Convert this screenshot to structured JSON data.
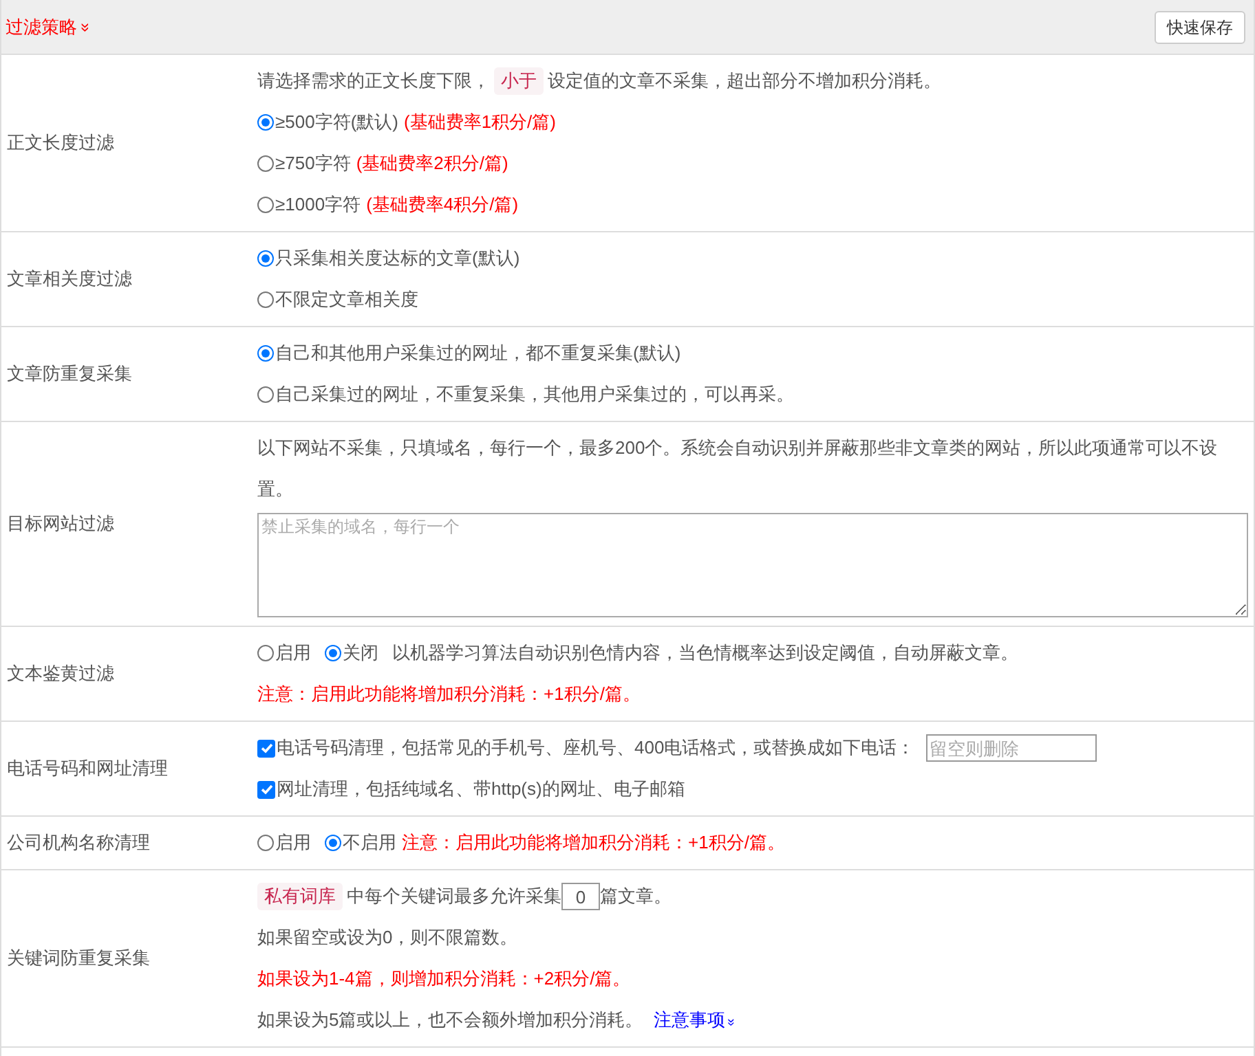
{
  "header": {
    "title": "过滤策略",
    "toggle": "»",
    "save_button": "快速保存"
  },
  "rows": [
    {
      "label": "正文长度过滤",
      "lines": [
        {
          "kind": "note",
          "parts": [
            {
              "text": "请选择需求的正文长度下限，"
            },
            {
              "text": "小于",
              "tag": true
            },
            {
              "text": "设定值的文章不采集，超出部分不增加积分消耗。"
            }
          ]
        },
        {
          "kind": "radio",
          "options": [
            {
              "label": "≥500字符(默认)",
              "selected": true
            }
          ],
          "extra": "(基础费率1积分/篇)"
        },
        {
          "kind": "radio",
          "options": [
            {
              "label": "≥750字符",
              "selected": false
            }
          ],
          "extra": "(基础费率2积分/篇)"
        },
        {
          "kind": "radio",
          "options": [
            {
              "label": "≥1000字符",
              "selected": false
            }
          ],
          "extra": "(基础费率4积分/篇)"
        }
      ]
    },
    {
      "label": "文章相关度过滤",
      "lines": [
        {
          "kind": "radio",
          "options": [
            {
              "label": "只采集相关度达标的文章(默认)",
              "selected": true
            }
          ]
        },
        {
          "kind": "radio",
          "options": [
            {
              "label": "不限定文章相关度",
              "selected": false
            }
          ]
        }
      ]
    },
    {
      "label": "文章防重复采集",
      "lines": [
        {
          "kind": "radio",
          "options": [
            {
              "label": "自己和其他用户采集过的网址，都不重复采集(默认)",
              "selected": true
            }
          ]
        },
        {
          "kind": "radio",
          "options": [
            {
              "label": "自己采集过的网址，不重复采集，其他用户采集过的，可以再采。",
              "selected": false
            }
          ]
        }
      ]
    },
    {
      "label": "目标网站过滤",
      "lines": [
        {
          "kind": "note",
          "parts": [
            {
              "text": "以下网站不采集，只填域名，每行一个，最多200个。系统会自动识别并屏蔽那些非文章类的网站，所以此项通常可以不设置。"
            }
          ]
        },
        {
          "kind": "textarea",
          "placeholder": "禁止采集的域名，每行一个"
        }
      ]
    },
    {
      "label": "文本鉴黄过滤",
      "lines": [
        {
          "kind": "radio",
          "options": [
            {
              "label": "启用",
              "selected": false
            },
            {
              "label": "关闭",
              "selected": true
            }
          ],
          "extra_gray": "以机器学习算法自动识别色情内容，当色情概率达到设定阈值，自动屏蔽文章。"
        },
        {
          "kind": "warn",
          "text": "注意：启用此功能将增加积分消耗：+1积分/篇。"
        }
      ]
    },
    {
      "label": "电话号码和网址清理",
      "lines": [
        {
          "kind": "checkbox",
          "label": "电话号码清理，包括常见的手机号、座机号、400电话格式，或替换成如下电话：",
          "checked": true,
          "placeholder": "留空则删除"
        },
        {
          "kind": "checkbox",
          "label": "网址清理，包括纯域名、带http(s)的网址、电子邮箱",
          "checked": true
        }
      ]
    },
    {
      "label": "公司机构名称清理",
      "lines": [
        {
          "kind": "radio",
          "options": [
            {
              "label": "启用",
              "selected": false
            },
            {
              "label": "不启用",
              "selected": true
            }
          ],
          "extra": "注意：启用此功能将增加积分消耗：+1积分/篇。"
        }
      ]
    },
    {
      "label": "关键词防重复采集",
      "lines": [
        {
          "kind": "limit",
          "tag": "私有词库",
          "before": "中每个关键词最多允许采集",
          "value": "0",
          "after": "篇文章。"
        },
        {
          "kind": "note",
          "parts": [
            {
              "text": "如果留空或设为0，则不限篇数。"
            }
          ]
        },
        {
          "kind": "warn",
          "text": "如果设为1-4篇，则增加积分消耗：+2积分/篇。"
        },
        {
          "kind": "note",
          "parts": [
            {
              "text": "如果设为5篇或以上，也不会额外增加积分消耗。"
            }
          ],
          "link": "注意事项",
          "link_icon": "»"
        }
      ]
    }
  ]
}
